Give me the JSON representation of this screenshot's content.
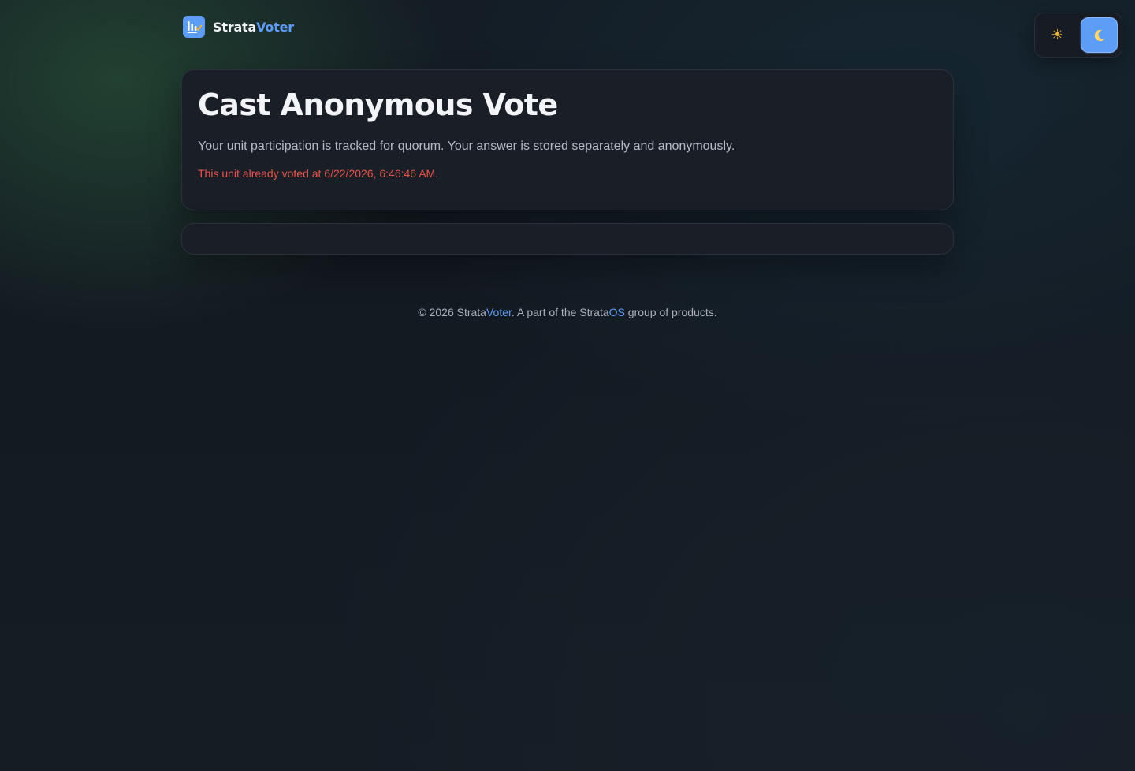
{
  "brand": {
    "name_part_a": "Strata",
    "name_part_b": "Voter",
    "logo_icon": "bar-chart-check-icon",
    "accent_color": "#5d9df5"
  },
  "theme_toggle": {
    "light_icon": "sun-icon",
    "light_glyph": "☀",
    "dark_icon": "moon-icon",
    "dark_glyph": "🌙",
    "selected": "dark"
  },
  "main": {
    "title": "Cast Anonymous Vote",
    "description": "Your unit participation is tracked for quorum. Your answer is stored separately and anonymously.",
    "status_message": "This unit already voted at 6/22/2026, 6:46:46 AM.",
    "status_color": "#e5534b"
  },
  "footer": {
    "prefix": "© 2026 Strata",
    "brand_accent": "Voter",
    "middle": ". A part of the Strata",
    "group_accent": "OS",
    "suffix": " group of products."
  }
}
